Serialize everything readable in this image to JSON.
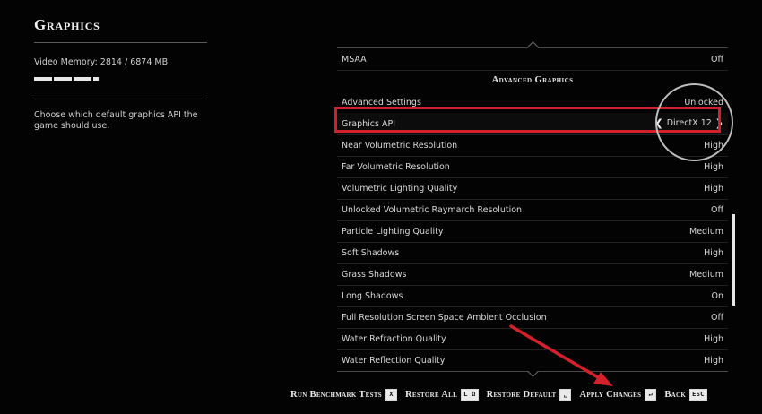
{
  "page": {
    "title": "Graphics",
    "vram_label": "Video Memory: 2814 / 6874 MB",
    "vram_fraction": 0.41,
    "description": "Choose which default graphics API the game should use."
  },
  "panel": {
    "top_row": {
      "label": "MSAA",
      "value": "Off"
    },
    "section_header": "Advanced Graphics",
    "rows": [
      {
        "label": "Advanced Settings",
        "value": "Unlocked"
      },
      {
        "label": "Graphics API",
        "value": "DirectX 12",
        "selected": true
      },
      {
        "label": "Near Volumetric Resolution",
        "value": "High"
      },
      {
        "label": "Far Volumetric Resolution",
        "value": "High"
      },
      {
        "label": "Volumetric Lighting Quality",
        "value": "High"
      },
      {
        "label": "Unlocked Volumetric Raymarch Resolution",
        "value": "Off"
      },
      {
        "label": "Particle Lighting Quality",
        "value": "Medium"
      },
      {
        "label": "Soft Shadows",
        "value": "High"
      },
      {
        "label": "Grass Shadows",
        "value": "Medium"
      },
      {
        "label": "Long Shadows",
        "value": "On"
      },
      {
        "label": "Full Resolution Screen Space Ambient Occlusion",
        "value": "Off"
      },
      {
        "label": "Water Refraction Quality",
        "value": "High"
      },
      {
        "label": "Water Reflection Quality",
        "value": "High"
      }
    ]
  },
  "footer": [
    {
      "label": "Run Benchmark Tests",
      "key": "X"
    },
    {
      "label": "Restore All",
      "key": "L Ω"
    },
    {
      "label": "Restore Default",
      "key": "␣"
    },
    {
      "label": "Apply Changes",
      "key": "↵"
    },
    {
      "label": "Back",
      "key": "ESC"
    }
  ],
  "colors": {
    "highlight": "#d4202b",
    "annotation_circle": "#bdbdbd",
    "background": "#030303"
  },
  "icons": {
    "api_prev": "chevron-left-icon",
    "api_next": "chevron-right-icon"
  }
}
